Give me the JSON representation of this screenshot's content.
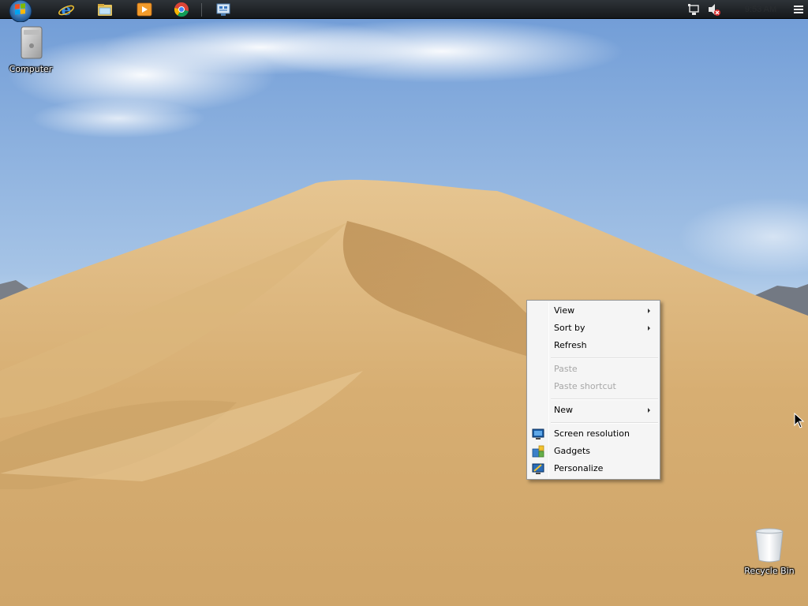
{
  "desktop": {
    "icons": [
      {
        "label": "Computer",
        "icon": "computer-icon"
      },
      {
        "label": "Recycle Bin",
        "icon": "recycle-bin-icon"
      }
    ],
    "wallpaper": {
      "sky_color": "#8fb3df",
      "sand_color": "#d8b47c"
    }
  },
  "taskbar": {
    "start_button": "start-orb-icon",
    "pinned": [
      {
        "name": "internet-explorer-icon"
      },
      {
        "name": "file-explorer-icon"
      },
      {
        "name": "media-player-icon"
      },
      {
        "name": "chrome-icon"
      },
      {
        "name": "control-panel-icon"
      }
    ],
    "tray": {
      "icons": [
        "network-icon",
        "volume-muted-icon"
      ],
      "clock": "9:53 AM"
    }
  },
  "context_menu": {
    "items": [
      {
        "label": "View",
        "submenu": true,
        "enabled": true
      },
      {
        "label": "Sort by",
        "submenu": true,
        "enabled": true
      },
      {
        "label": "Refresh",
        "submenu": false,
        "enabled": true
      },
      {
        "label": "Paste",
        "submenu": false,
        "enabled": false
      },
      {
        "label": "Paste shortcut",
        "submenu": false,
        "enabled": false
      },
      {
        "label": "New",
        "submenu": true,
        "enabled": true
      },
      {
        "label": "Screen resolution",
        "submenu": false,
        "enabled": true,
        "icon": "screen-resolution-icon"
      },
      {
        "label": "Gadgets",
        "submenu": false,
        "enabled": true,
        "icon": "gadgets-icon"
      },
      {
        "label": "Personalize",
        "submenu": false,
        "enabled": true,
        "icon": "personalize-icon"
      }
    ]
  }
}
